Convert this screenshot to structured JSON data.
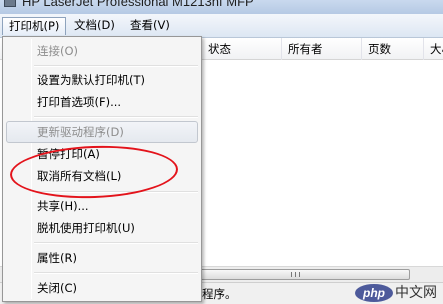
{
  "window": {
    "title": "HP LaserJet Professional M1213nf MFP"
  },
  "menubar": {
    "items": [
      {
        "label": "打印机(P)"
      },
      {
        "label": "文档(D)"
      },
      {
        "label": "查看(V)"
      }
    ]
  },
  "columns": [
    "状态",
    "所有者",
    "页数",
    "大小"
  ],
  "dropdown": {
    "items": [
      {
        "label": "连接(O)",
        "state": "disabled"
      },
      {
        "label": "设置为默认打印机(T)"
      },
      {
        "label": "打印首选项(F)..."
      },
      {
        "label": "更新驱动程序(D)",
        "state": "disabled"
      },
      {
        "label": "暂停打印(A)"
      },
      {
        "label": "取消所有文档(L)"
      },
      {
        "label": "共享(H)..."
      },
      {
        "label": "脱机使用打印机(U)"
      },
      {
        "label": "属性(R)"
      },
      {
        "label": "关闭(C)"
      }
    ]
  },
  "statusbar": {
    "text": "程序。"
  },
  "watermark": {
    "logo": "php",
    "text": "中文网"
  },
  "colors": {
    "annotation": "#e3131b",
    "menubar": "#dde7f3"
  }
}
